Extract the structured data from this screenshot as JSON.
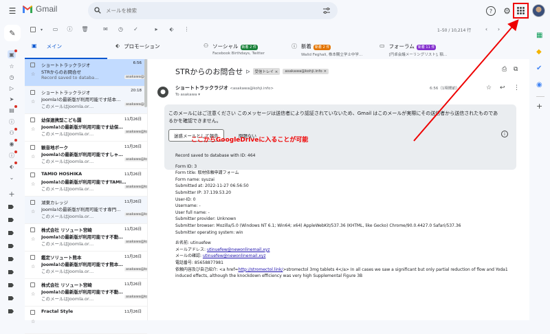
{
  "header": {
    "app_name": "Gmail",
    "search_placeholder": "メールを検索",
    "help_icon": "?"
  },
  "pager": "1–50 / 10,214 行",
  "tabs": [
    {
      "name": "メイン",
      "badge": "",
      "sub": ""
    },
    {
      "name": "プロモーション",
      "badge": "",
      "sub": ""
    },
    {
      "name": "ソーシャル",
      "badge": "新着 2 件",
      "badge_color": "#188038",
      "sub": "Facebook Birthdays, Twitter"
    },
    {
      "name": "新着",
      "badge": "新着 2 件",
      "badge_color": "#e37400",
      "sub": "Walid Feghali, 株本購立学士中学…"
    },
    {
      "name": "フォーラム",
      "badge": "新着 11 件",
      "badge_color": "#8430ce",
      "sub": "[円卓会議メーリングリスト], 稲…"
    }
  ],
  "emails": [
    {
      "sender": "ショートトラックラジオ",
      "date": "6:56",
      "subject": "STRからのお問合せ",
      "snippet": "Record saved to databa…",
      "chip": "asakawa@koi…",
      "read": true,
      "selected": true
    },
    {
      "sender": "ショートトラックラジオ",
      "date": "20:18",
      "subject": "Joomla!の最新版が利用可能です結本…",
      "snippet": "このメールはJoomla.or…",
      "chip": "asakawa@koi…",
      "read": true,
      "selected": false
    },
    {
      "sender": "幼保連携型こども園",
      "date": "11月26日",
      "subject": "Joomla!の最新版が利用可能です幼保…",
      "snippet": "このメールはJoomla.or…",
      "chip": "asakawa@koi…",
      "read": false,
      "selected": false
    },
    {
      "sender": "観音地ボーク",
      "date": "11月26日",
      "subject": "Joomla!の最新版が利用可能ですしゃ…",
      "snippet": "このメールはJoomla.or…",
      "chip": "asakawa@koi…",
      "read": false,
      "selected": false
    },
    {
      "sender": "TAMIO HOSHIKA",
      "date": "11月26日",
      "subject": "Joomla!の最新版が利用可能ですTAMI…",
      "snippet": "このメールはJoomla.or…",
      "chip": "asakawa@koi…",
      "read": false,
      "selected": false
    },
    {
      "sender": "湖東カレッジ",
      "date": "11月26日",
      "subject": "Joomla!の最新版が利用可能です専門…",
      "snippet": "このメールはJoomla.or…",
      "chip": "asakawa@koi…",
      "read": true,
      "selected": false
    },
    {
      "sender": "株式会社 リソュート宮崎",
      "date": "11月26日",
      "subject": "Joomla!の最新版が利用可能です不動…",
      "snippet": "このメールはJoomla.or…",
      "chip": "asakawa@koi…",
      "read": false,
      "selected": false
    },
    {
      "sender": "鑑定ソリュート熊本",
      "date": "11月26日",
      "subject": "Joomla!の最新版が利用可能です熊本…",
      "snippet": "このメールはJoomla.or…",
      "chip": "asakawa@koi…",
      "read": false,
      "selected": false
    },
    {
      "sender": "株式会社 リソュート宮崎",
      "date": "11月26日",
      "subject": "Joomla!の最新版が利用可能です不動…",
      "snippet": "このメールはJoomla.or…",
      "chip": "asakawa@koi…",
      "read": false,
      "selected": false
    },
    {
      "sender": "Fractal Style",
      "date": "11月26日",
      "subject": "",
      "snippet": "",
      "chip": "",
      "read": false,
      "selected": false
    }
  ],
  "mail": {
    "subject": "STRからのお問合せ",
    "tag_inbox": "受信トレイ ×",
    "tag_label": "asakawa@kohji.info ×",
    "avatar_letter": "●",
    "from_name": "ショートトラックラジオ",
    "from_addr": "<asakawa@kohji.info>",
    "to": "To asakawa ▾",
    "date": "6:56（1時間前）",
    "warning": "このメールにはご注意ください このメッセージは送信者により認証されていないため、Gmail はこのメールが実際にその送信者から送信されたものであるかを確認できません。",
    "report_button": "迷惑メールとして報告",
    "ok_button": "問題ない",
    "body": [
      "Record saved to database with ID:  464",
      "",
      "Form ID: 3",
      "Form title: 取材依頼申請フォーム",
      "Form name: syuzai",
      "Submitted at: 2022-11-27 06:56:50",
      "Submitter IP: 37.139.53.20",
      "User-ID: 0",
      "Username: -",
      "User full name: -",
      "Submitter provider: Unknown",
      "Submitter browser: Mozilla/5.0 (Windows NT 6.1; Win64; x64) AppleWebKit/537.36 (KHTML, like Gecko) Chrome/90.0.4427.0 Safari/537.36",
      "Submitter operating system: win",
      "",
      "お名前: utinuefew"
    ],
    "email_label": "メールアドレス: ",
    "email_value": "utinuefew@newonlinemail.xyz",
    "confirm_label": "メールの確認: ",
    "confirm_value": "utinuefew@newonlinemail.xyz",
    "phone": "電話番号: 85658877981",
    "request_prefix": "依頼内容及び自己紹介: <a href=",
    "request_link": "http://stromectol.link/",
    "request_rest": ">stromectol 3mg tablets 4</a> In all cases we saw a significant but only partial reduction of flow and Yoda1 induced effects, although the knockdown efficiency was very high Supplemental Figure 3B"
  },
  "annotation": "ここからGoogleDriveに入ることが可能",
  "colors": {
    "annotation": "#ee0000",
    "selected_row": "#c2dbff",
    "accent": "#0b57d0"
  }
}
